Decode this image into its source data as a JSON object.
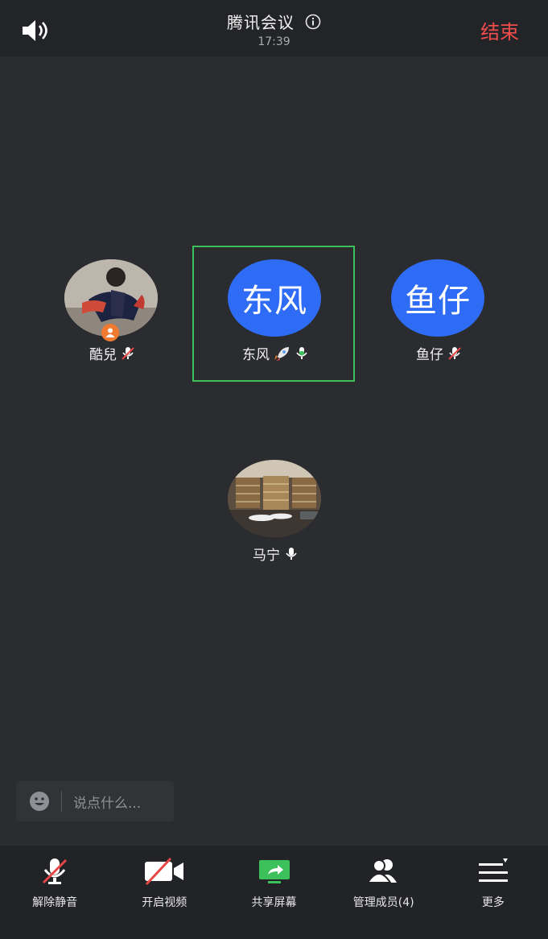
{
  "header": {
    "title": "腾讯会议",
    "time": "17:39",
    "end_label": "结束"
  },
  "participants": [
    {
      "name": "酷兒",
      "avatar_type": "photo-person",
      "mic": "muted",
      "role": "host"
    },
    {
      "name": "东风",
      "avatar_text": "东风",
      "mic": "on",
      "badge": "rocket",
      "speaking": true
    },
    {
      "name": "鱼仔",
      "avatar_text": "鱼仔",
      "mic": "muted"
    },
    {
      "name": "马宁",
      "avatar_type": "photo-room",
      "mic": "on"
    }
  ],
  "chat": {
    "placeholder": "说点什么..."
  },
  "toolbar": {
    "unmute": "解除静音",
    "video": "开启视频",
    "share": "共享屏幕",
    "members": "管理成员(4)",
    "more": "更多"
  },
  "colors": {
    "background": "#2b2c30",
    "bar": "#232427",
    "end_red": "#f24c4c",
    "avatar_blue": "#2f6cf6",
    "speaking_green": "#3cc05a",
    "host_orange": "#f07a2f"
  }
}
